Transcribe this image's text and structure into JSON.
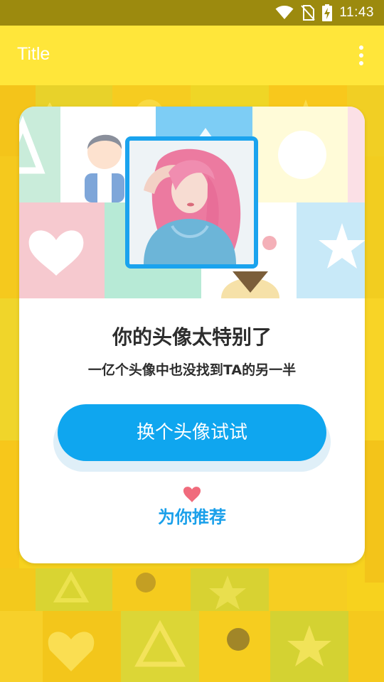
{
  "status_bar": {
    "time": "11:43",
    "icons": [
      "wifi-icon",
      "no-sim-icon",
      "battery-charging-icon"
    ]
  },
  "app_bar": {
    "title": "Title",
    "overflow_icon": "more-vert-icon"
  },
  "card": {
    "title": "你的头像太特别了",
    "subtitle": "一亿个头像中也没找到TA的另一半",
    "change_button_label": "换个头像试试",
    "recommend_icon": "heart-icon",
    "recommend_label": "为你推荐"
  },
  "colors": {
    "app_bar": "#ffe63a",
    "status_bar": "#9c8a0e",
    "primary_button": "#0fa6ef",
    "avatar_border": "#1aa3ee",
    "heart": "#f06b7c",
    "recommend_text": "#1aa0ea"
  }
}
